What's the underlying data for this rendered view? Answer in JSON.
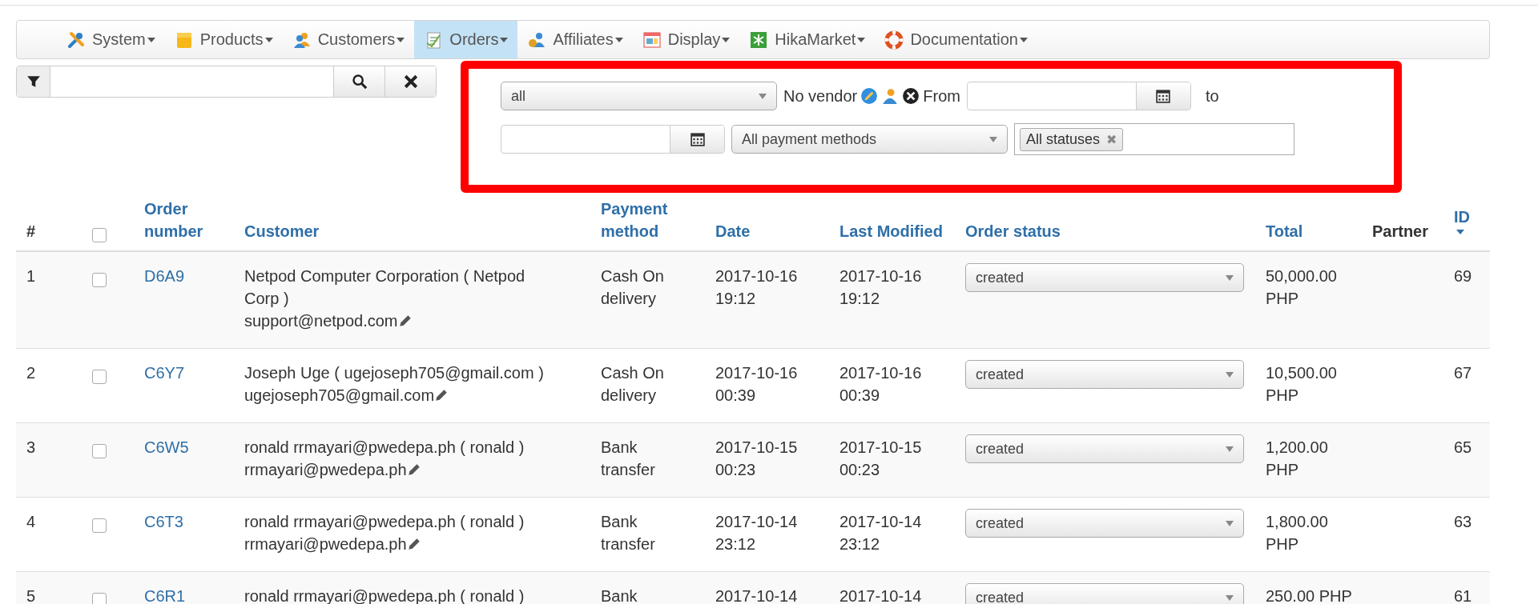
{
  "menu": [
    {
      "label": "System",
      "selected": false
    },
    {
      "label": "Products",
      "selected": false
    },
    {
      "label": "Customers",
      "selected": false
    },
    {
      "label": "Orders",
      "selected": true
    },
    {
      "label": "Affiliates",
      "selected": false
    },
    {
      "label": "Display",
      "selected": false
    },
    {
      "label": "HikaMarket",
      "selected": false
    },
    {
      "label": "Documentation",
      "selected": false
    }
  ],
  "filters": {
    "vendor_select": "all",
    "vendor_text": "No vendor",
    "from_label": "From",
    "to_label": "to",
    "payment_select": "All payment methods",
    "status_tags": [
      "All statuses"
    ],
    "status_tag_remove": "✖"
  },
  "table": {
    "columns": [
      {
        "label": "#",
        "kind": "plain"
      },
      {
        "kind": "checkbox",
        "checked": false
      },
      {
        "label": "Order number",
        "kind": "link"
      },
      {
        "label": "Customer",
        "kind": "link"
      },
      {
        "label": "Payment method",
        "kind": "link"
      },
      {
        "label": "Date",
        "kind": "link"
      },
      {
        "label": "Last Modified",
        "kind": "link"
      },
      {
        "label": "Order status",
        "kind": "link"
      },
      {
        "label": "Total",
        "kind": "link"
      },
      {
        "label": "Partner",
        "kind": "plain"
      },
      {
        "label": "ID",
        "kind": "sorted"
      }
    ],
    "rows": [
      {
        "index": "1",
        "checked": false,
        "order_number": "D6A9",
        "customer": "Netpod Computer Corporation ( Netpod Corp )",
        "email": "support@netpod.com",
        "payment": "Cash On delivery",
        "date": "2017-10-16 19:12",
        "modified": "2017-10-16 19:12",
        "status": "created",
        "total": "50,000.00 PHP",
        "id": "69"
      },
      {
        "index": "2",
        "checked": false,
        "order_number": "C6Y7",
        "customer": "Joseph Uge ( ugejoseph705@gmail.com )",
        "email": "ugejoseph705@gmail.com",
        "payment": "Cash On delivery",
        "date": "2017-10-16 00:39",
        "modified": "2017-10-16 00:39",
        "status": "created",
        "total": "10,500.00 PHP",
        "id": "67"
      },
      {
        "index": "3",
        "checked": false,
        "order_number": "C6W5",
        "customer": "ronald rrmayari@pwedepa.ph ( ronald )",
        "email": "rrmayari@pwedepa.ph",
        "payment": "Bank transfer",
        "date": "2017-10-15 00:23",
        "modified": "2017-10-15 00:23",
        "status": "created",
        "total": "1,200.00 PHP",
        "id": "65"
      },
      {
        "index": "4",
        "checked": false,
        "order_number": "C6T3",
        "customer": "ronald rrmayari@pwedepa.ph ( ronald )",
        "email": "rrmayari@pwedepa.ph",
        "payment": "Bank transfer",
        "date": "2017-10-14 23:12",
        "modified": "2017-10-14 23:12",
        "status": "created",
        "total": "1,800.00 PHP",
        "id": "63"
      },
      {
        "index": "5",
        "checked": false,
        "order_number": "C6R1",
        "customer": "ronald rrmayari@pwedepa.ph ( ronald )",
        "payment": "Bank",
        "date": "2017-10-14",
        "modified": "2017-10-14",
        "status": "created",
        "total": "250.00 PHP",
        "id": "61"
      }
    ]
  }
}
